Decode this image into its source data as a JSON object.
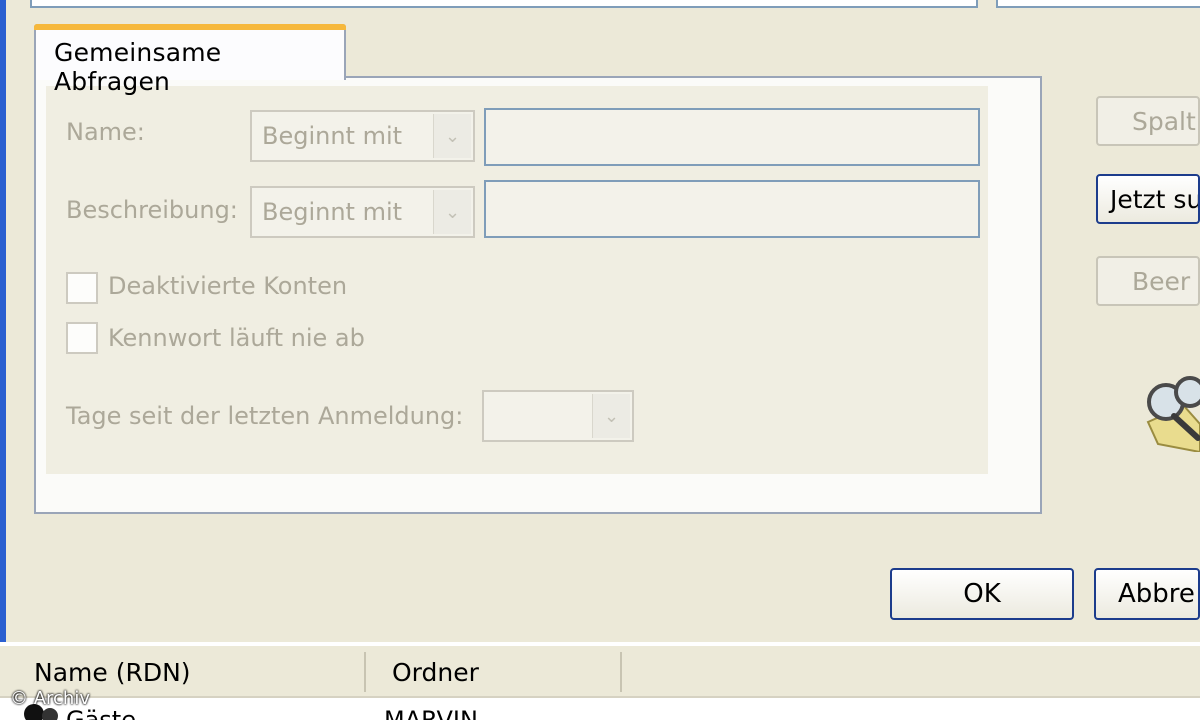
{
  "tab": {
    "label": "Gemeinsame Abfragen"
  },
  "form": {
    "name_label": "Name:",
    "name_condition": "Beginnt mit",
    "name_value": "",
    "description_label": "Beschreibung:",
    "description_condition": "Beginnt mit",
    "description_value": "",
    "disabled_accounts_label": "Deaktivierte Konten",
    "password_never_expires_label": "Kennwort läuft nie ab",
    "days_since_logon_label": "Tage seit der letzten Anmeldung:",
    "days_since_logon_value": ""
  },
  "side_buttons": {
    "columns": "Spalt",
    "search_now": "Jetzt su",
    "stop": "Beer"
  },
  "dialog_buttons": {
    "ok": "OK",
    "cancel": "Abbre"
  },
  "results": {
    "columns": [
      "Name (RDN)",
      "Ordner"
    ],
    "rows": [
      {
        "name": "Gäste",
        "folder": "MARVIN"
      }
    ]
  },
  "watermark": "© Archiv",
  "colors": {
    "accent_tab": "#f6b83c",
    "button_border": "#1c3c8c",
    "disabled_text": "#aca899",
    "window_frame": "#2a5fd0"
  }
}
